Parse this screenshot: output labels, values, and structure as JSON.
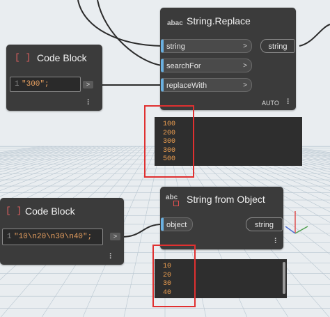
{
  "colors": {
    "node_bg": "#3b3b3b",
    "preview_text": "#f0a050",
    "highlight_box": "#e03030",
    "port_accent": "#6ab0e0",
    "code_text": "#e8a060"
  },
  "nodes": {
    "code_block_1": {
      "title": "Code Block",
      "icon": "code-block-icon",
      "icon_text": "[ ]",
      "line_number": "1",
      "code": "\"300\";",
      "output_label": ">"
    },
    "string_replace": {
      "title": "String.Replace",
      "icon": "abac-icon",
      "icon_text": "abac",
      "inputs": [
        "string",
        "searchFor",
        "replaceWith"
      ],
      "input_chevron": ">",
      "output": "string",
      "lacing": "AUTO",
      "preview_lines": [
        "100",
        "200",
        "300",
        "300",
        "500"
      ]
    },
    "code_block_2": {
      "title": "Code Block",
      "icon": "code-block-icon",
      "icon_text": "[ ]",
      "line_number": "1",
      "code": "\"10\\n20\\n30\\n40\";",
      "output_label": ">"
    },
    "string_from_object": {
      "title": "String from Object",
      "icon": "abc-icon",
      "icon_text": "abc",
      "inputs": [
        "object"
      ],
      "output": "string",
      "preview_lines": [
        "10",
        "20",
        "30",
        "40"
      ]
    }
  }
}
